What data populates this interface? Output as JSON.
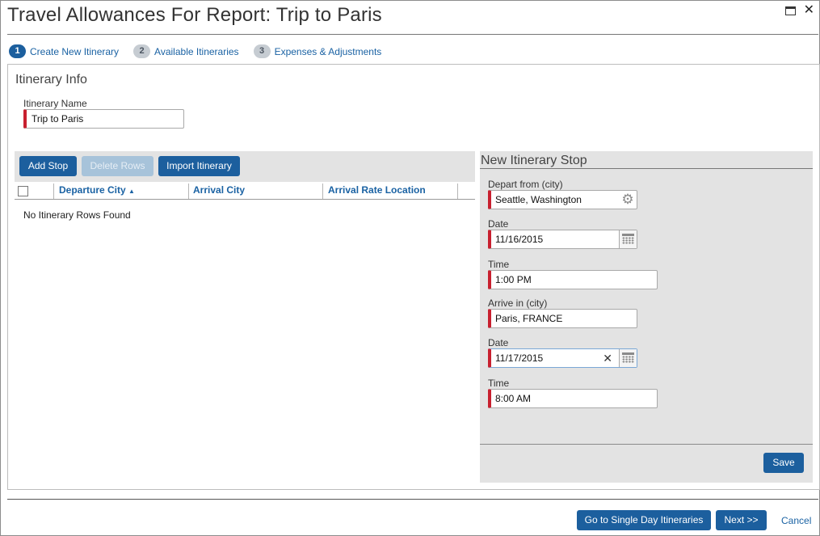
{
  "dialog": {
    "title": "Travel Allowances For Report: Trip to Paris"
  },
  "steps": [
    {
      "num": "1",
      "label": "Create New Itinerary",
      "active": true
    },
    {
      "num": "2",
      "label": "Available Itineraries",
      "active": false
    },
    {
      "num": "3",
      "label": "Expenses & Adjustments",
      "active": false
    }
  ],
  "itinerary_info": {
    "title": "Itinerary Info",
    "name_label": "Itinerary Name",
    "name_value": "Trip to Paris"
  },
  "toolbar": {
    "add_stop": "Add Stop",
    "delete_rows": "Delete Rows",
    "import_itinerary": "Import Itinerary"
  },
  "grid": {
    "columns": [
      "Departure City",
      "Arrival City",
      "Arrival Rate Location"
    ],
    "sort_indicator": "▲",
    "empty_message": "No Itinerary Rows Found"
  },
  "new_stop": {
    "title": "New Itinerary Stop",
    "depart_label": "Depart from (city)",
    "depart_value": "Seattle, Washington",
    "depart_date_label": "Date",
    "depart_date_value": "11/16/2015",
    "depart_time_label": "Time",
    "depart_time_value": "1:00 PM",
    "arrive_label": "Arrive in (city)",
    "arrive_value": "Paris, FRANCE",
    "arrive_date_label": "Date",
    "arrive_date_value": "11/17/2015",
    "arrive_time_label": "Time",
    "arrive_time_value": "8:00 AM",
    "save": "Save"
  },
  "footer": {
    "single_day": "Go to Single Day Itineraries",
    "next": "Next >>",
    "cancel": "Cancel"
  },
  "colors": {
    "primary": "#1c5f9e",
    "required": "#c8202f",
    "link": "#1a62a3"
  }
}
